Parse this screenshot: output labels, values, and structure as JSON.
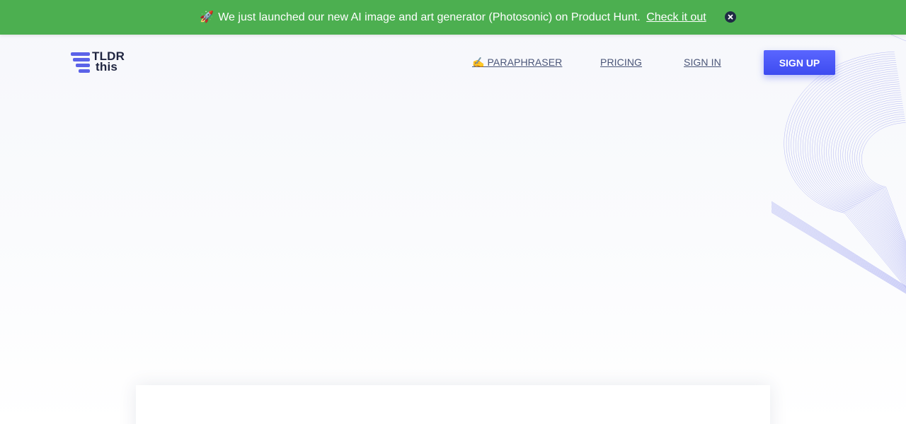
{
  "banner": {
    "emoji": "🚀",
    "message": "We just launched our new AI image and art generator (Photosonic) on Product Hunt.",
    "link_label": "Check it out",
    "close_icon": "close-circle-icon",
    "background": "#4caf50"
  },
  "header": {
    "logo": {
      "line1": "TLDR",
      "line2": "this",
      "icon": "stacked-lines-logo-icon",
      "color": "#5b62e8"
    },
    "nav": {
      "paraphraser_label": "✍️ PARAPHRASER",
      "pricing_label": "PRICING",
      "signin_label": "SIGN IN",
      "signup_label": "SIGN UP"
    },
    "accent": "#4452f6"
  }
}
